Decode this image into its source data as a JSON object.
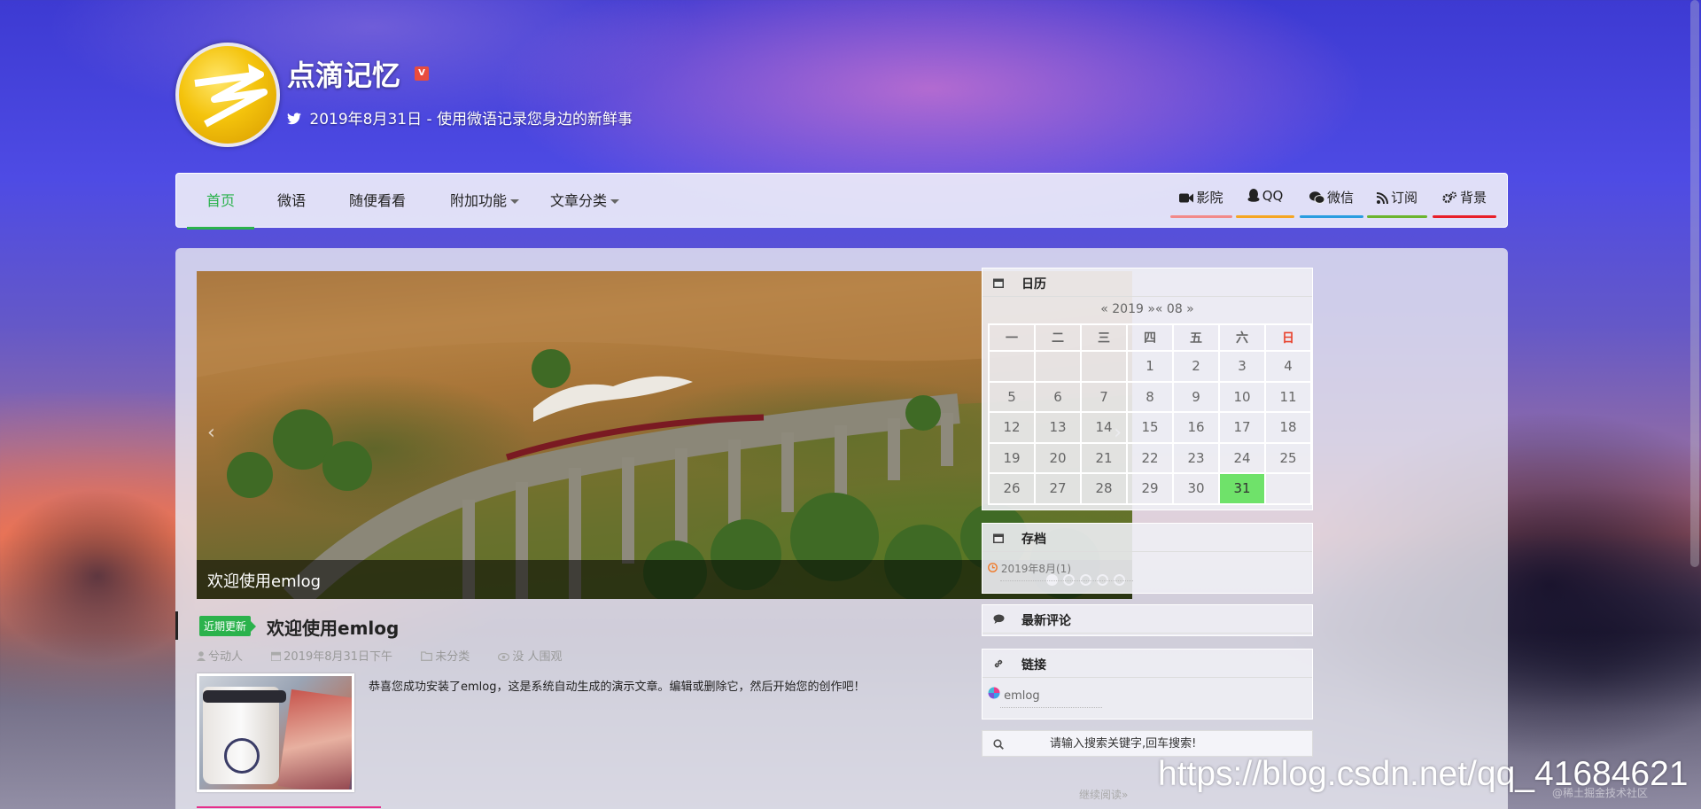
{
  "site": {
    "title": "点滴记忆",
    "badge": "V",
    "description": "2019年8月31日 - 使用微语记录您身边的新鲜事"
  },
  "nav": {
    "items": [
      {
        "label": "首页",
        "active": true
      },
      {
        "label": "微语"
      },
      {
        "label": "随便看看"
      },
      {
        "label": "附加功能",
        "dropdown": true
      },
      {
        "label": "文章分类",
        "dropdown": true
      }
    ],
    "right_links": [
      {
        "label": "影院",
        "icon": "video-camera-icon",
        "color": "#f28a8a"
      },
      {
        "label": "QQ",
        "icon": "qq-icon",
        "color": "#f5a623"
      },
      {
        "label": "微信",
        "icon": "wechat-icon",
        "color": "#2a9de0"
      },
      {
        "label": "订阅",
        "icon": "rss-icon",
        "color": "#6bb52f"
      },
      {
        "label": "背景",
        "icon": "gears-icon",
        "color": "#e8202a"
      }
    ]
  },
  "slider": {
    "caption": "欢迎使用emlog",
    "dots": 5,
    "active_dot": 0
  },
  "post": {
    "tag": "近期更新",
    "title": "欢迎使用emlog",
    "author": "兮动人",
    "date": "2019年8月31日下午",
    "category": "未分类",
    "views": "没 人围观",
    "excerpt": "恭喜您成功安装了emlog，这是系统自动生成的演示文章。编辑或删除它，然后开始您的创作吧！",
    "read_more": "继续阅读»"
  },
  "sidebar": {
    "calendar": {
      "title": "日历",
      "nav": "« 2019 »« 08 »",
      "weekdays": [
        "一",
        "二",
        "三",
        "四",
        "五",
        "六",
        "日"
      ],
      "weeks": [
        [
          "",
          "",
          "",
          "1",
          "2",
          "3",
          "4"
        ],
        [
          "5",
          "6",
          "7",
          "8",
          "9",
          "10",
          "11"
        ],
        [
          "12",
          "13",
          "14",
          "15",
          "16",
          "17",
          "18"
        ],
        [
          "19",
          "20",
          "21",
          "22",
          "23",
          "24",
          "25"
        ],
        [
          "26",
          "27",
          "28",
          "29",
          "30",
          "31",
          ""
        ]
      ],
      "today": "31"
    },
    "archive": {
      "title": "存档",
      "items": [
        "2019年8月(1)"
      ]
    },
    "comments": {
      "title": "最新评论"
    },
    "links": {
      "title": "链接",
      "items": [
        "emlog"
      ]
    },
    "search": {
      "placeholder": "请输入搜索关键字,回车搜索!"
    }
  },
  "watermark": "https://blog.csdn.net/qq_41684621",
  "watermark_small": "@稀土掘金技术社区",
  "colors": {
    "accent": "#2ab24c",
    "pink": "#e62e8a",
    "today": "#6fe26a"
  }
}
